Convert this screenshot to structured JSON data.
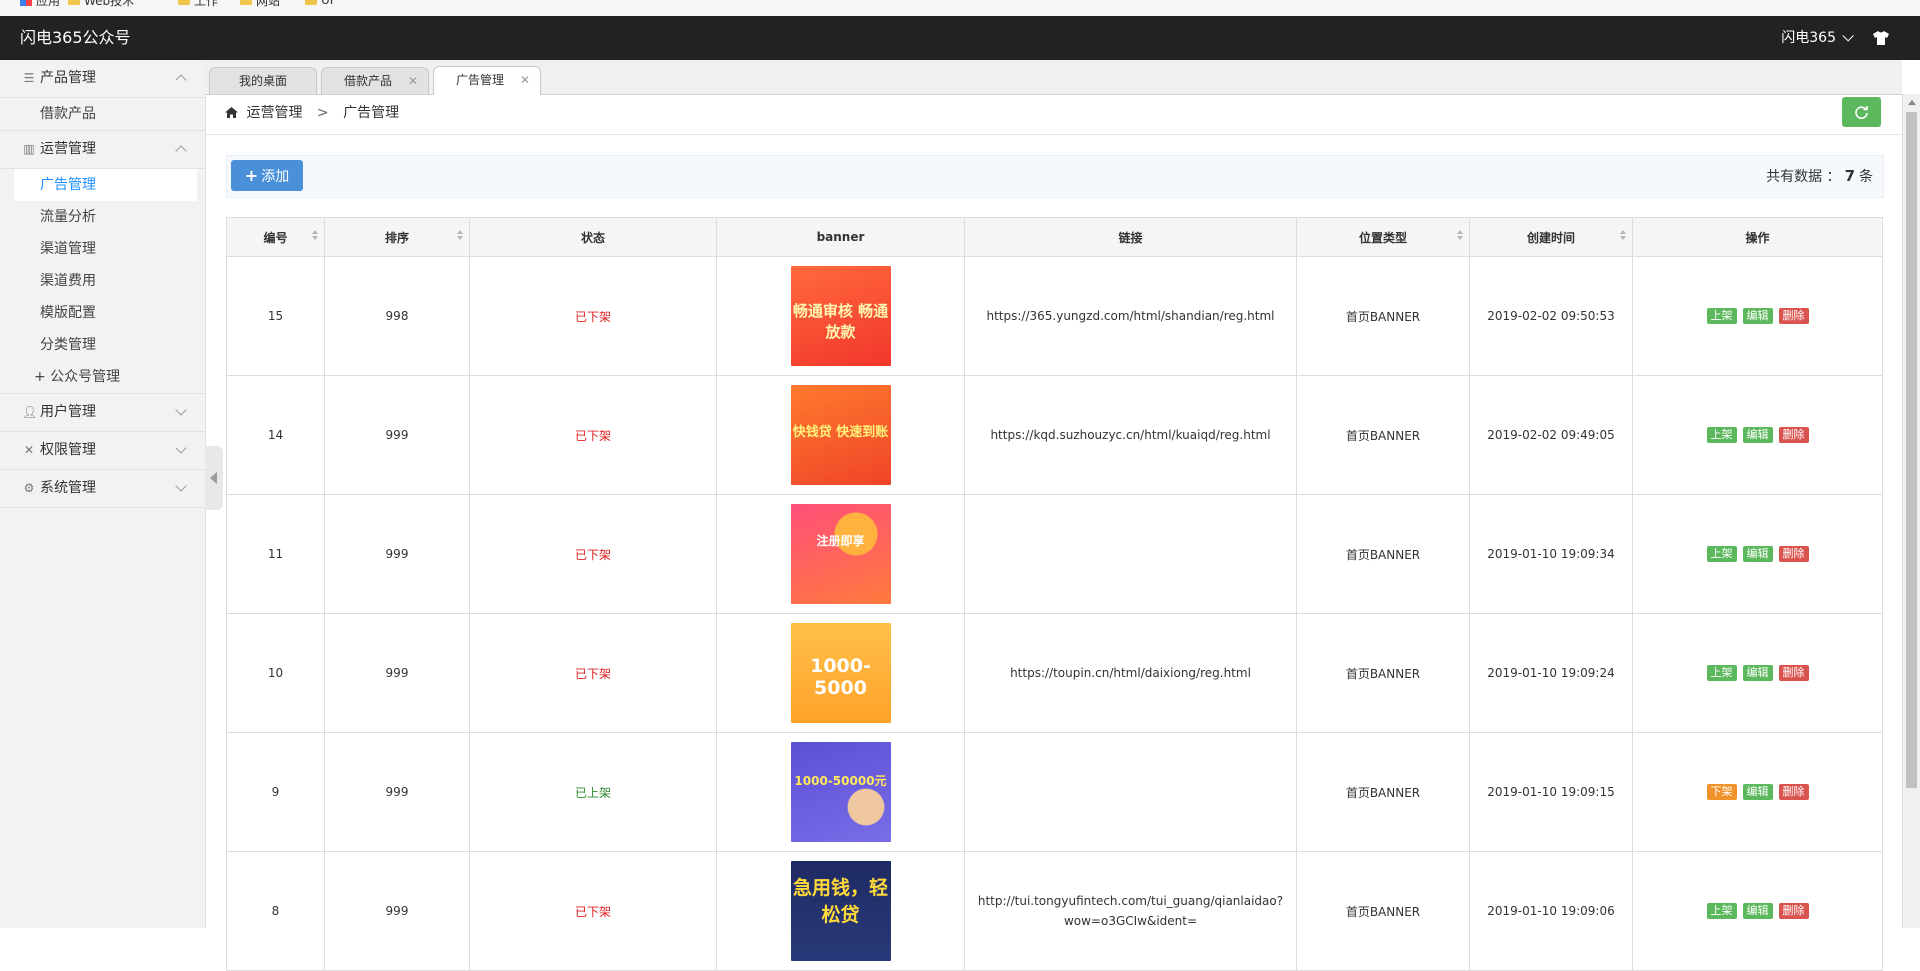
{
  "bookmarks": [
    "应用",
    "Web技术",
    "工作",
    "网站",
    "UI"
  ],
  "header": {
    "app_title": "闪电365公众号",
    "user_name": "闪电365"
  },
  "sidebar": {
    "groups": [
      {
        "label": "产品管理",
        "icon": "list-icon",
        "expanded": true,
        "items": [
          "借款产品"
        ]
      },
      {
        "label": "运营管理",
        "icon": "chart-icon",
        "expanded": true,
        "items": [
          "广告管理",
          "流量分析",
          "渠道管理",
          "渠道费用",
          "模版配置",
          "分类管理",
          "+ 公众号管理"
        ],
        "active_item": "广告管理"
      },
      {
        "label": "用户管理",
        "icon": "user-icon",
        "expanded": false
      },
      {
        "label": "权限管理",
        "icon": "tools-icon",
        "expanded": false
      },
      {
        "label": "系统管理",
        "icon": "gear-icon",
        "expanded": false
      }
    ]
  },
  "tabs": [
    {
      "label": "我的桌面",
      "closable": false
    },
    {
      "label": "借款产品",
      "closable": true
    },
    {
      "label": "广告管理",
      "closable": true,
      "active": true
    }
  ],
  "breadcrumb": {
    "parent": "运营管理",
    "separator": ">",
    "current": "广告管理"
  },
  "toolbar": {
    "add_label": "添加",
    "total_prefix": "共有数据 ：",
    "total_count": "7",
    "total_suffix": "条"
  },
  "table": {
    "columns": [
      "编号",
      "排序",
      "状态",
      "banner",
      "链接",
      "位置类型",
      "创建时间",
      "操作"
    ],
    "rows": [
      {
        "id": "15",
        "sort": "998",
        "status": "已下架",
        "status_on": false,
        "link": "https://365.yungzd.com/html/shandian/reg.html",
        "position": "首页BANNER",
        "created": "2019-02-02 09:50:53",
        "toggle": "上架",
        "edit": "编辑",
        "delete": "删除",
        "banner_text": "畅通审核 畅通放款"
      },
      {
        "id": "14",
        "sort": "999",
        "status": "已下架",
        "status_on": false,
        "link": "https://kqd.suzhouzyc.cn/html/kuaiqd/reg.html",
        "position": "首页BANNER",
        "created": "2019-02-02 09:49:05",
        "toggle": "上架",
        "edit": "编辑",
        "delete": "删除",
        "banner_text": "快钱贷 快速到账"
      },
      {
        "id": "11",
        "sort": "999",
        "status": "已下架",
        "status_on": false,
        "link": "",
        "position": "首页BANNER",
        "created": "2019-01-10 19:09:34",
        "toggle": "上架",
        "edit": "编辑",
        "delete": "删除",
        "banner_text": "注册即享"
      },
      {
        "id": "10",
        "sort": "999",
        "status": "已下架",
        "status_on": false,
        "link": "https://toupin.cn/html/daixiong/reg.html",
        "position": "首页BANNER",
        "created": "2019-01-10 19:09:24",
        "toggle": "上架",
        "edit": "编辑",
        "delete": "删除",
        "banner_text": "1000-5000"
      },
      {
        "id": "9",
        "sort": "999",
        "status": "已上架",
        "status_on": true,
        "link": "",
        "position": "首页BANNER",
        "created": "2019-01-10 19:09:15",
        "toggle": "下架",
        "edit": "编辑",
        "delete": "删除",
        "banner_text": "1000-50000元"
      },
      {
        "id": "8",
        "sort": "999",
        "status": "已下架",
        "status_on": false,
        "link": "http://tui.tongyufintech.com/tui_guang/qianlaidao?wow=o3GCIw&ident=",
        "position": "首页BANNER",
        "created": "2019-01-10 19:09:06",
        "toggle": "上架",
        "edit": "编辑",
        "delete": "删除",
        "banner_text": "急用钱，轻松贷"
      }
    ]
  },
  "colors": {
    "header_bg": "#222222",
    "sidebar_active_text": "#1e90ff",
    "add_button": "#4a90d9",
    "refresh_button": "#5cb85c",
    "status_off": "#e02020",
    "status_on": "#2d8a2d",
    "btn_green": "#5cb85c",
    "btn_orange": "#f0932b",
    "btn_red": "#d9534f"
  }
}
